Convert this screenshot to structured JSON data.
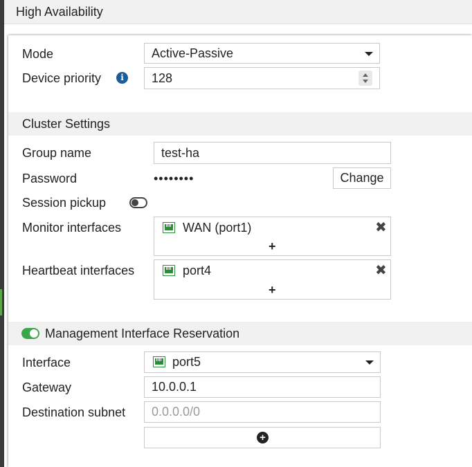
{
  "header": {
    "title": "High Availability"
  },
  "mode": {
    "label": "Mode",
    "value": "Active-Passive"
  },
  "device_priority": {
    "label": "Device priority",
    "value": "128"
  },
  "cluster": {
    "section_title": "Cluster Settings",
    "group_name": {
      "label": "Group name",
      "value": "test-ha"
    },
    "password": {
      "label": "Password",
      "masked": "••••••••",
      "change_label": "Change"
    },
    "session_pickup": {
      "label": "Session pickup",
      "enabled": false
    },
    "monitor_interfaces": {
      "label": "Monitor interfaces",
      "items": [
        "WAN (port1)"
      ],
      "add_symbol": "+"
    },
    "heartbeat_interfaces": {
      "label": "Heartbeat interfaces",
      "items": [
        "port4"
      ],
      "add_symbol": "+"
    }
  },
  "mgmt": {
    "section_title": "Management Interface Reservation",
    "enabled": true,
    "interface": {
      "label": "Interface",
      "value": "port5"
    },
    "gateway": {
      "label": "Gateway",
      "value": "10.0.0.1"
    },
    "destination_subnet": {
      "label": "Destination subnet",
      "placeholder": "0.0.0.0/0"
    }
  },
  "icons": {
    "info": "info-icon",
    "port": "network-port-icon",
    "remove": "close-icon",
    "add": "plus-icon",
    "add_circle": "plus-circle-icon",
    "dropdown": "chevron-down-icon"
  },
  "colors": {
    "accent_green": "#3ea64a",
    "info_blue": "#1b5c99",
    "port_green": "#2e8b3a"
  }
}
